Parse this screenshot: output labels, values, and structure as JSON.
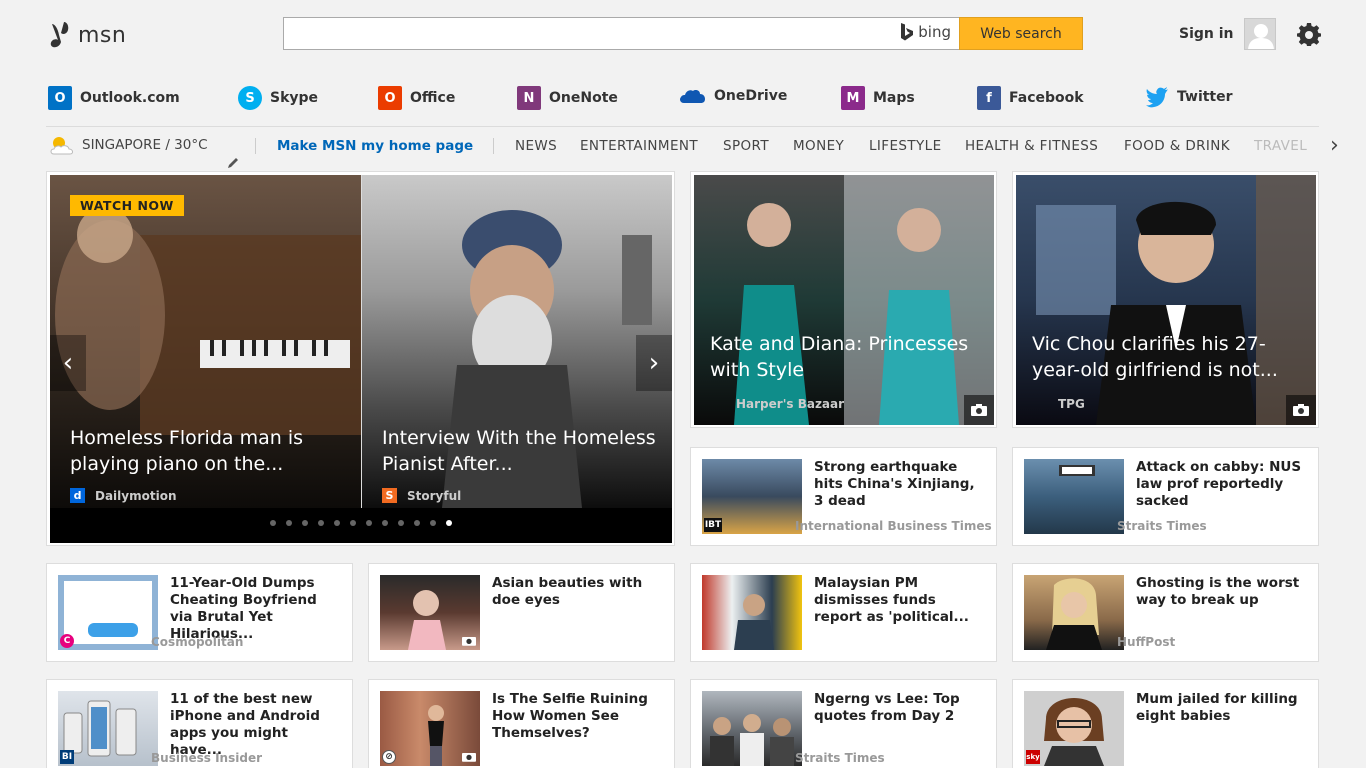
{
  "header": {
    "logo_text": "msn",
    "search_placeholder": "",
    "bing_label": "bing",
    "search_button": "Web search",
    "signin": "Sign in"
  },
  "apps": [
    {
      "label": "Outlook.com",
      "icon": "outlook-icon",
      "color": "#0072c6"
    },
    {
      "label": "Skype",
      "icon": "skype-icon",
      "color": "#00aff0"
    },
    {
      "label": "Office",
      "icon": "office-icon",
      "color": "#eb3c00"
    },
    {
      "label": "OneNote",
      "icon": "onenote-icon",
      "color": "#80397b"
    },
    {
      "label": "OneDrive",
      "icon": "onedrive-icon",
      "color": "#0f57b2"
    },
    {
      "label": "Maps",
      "icon": "maps-icon",
      "color": "#8b2a8b"
    },
    {
      "label": "Facebook",
      "icon": "facebook-icon",
      "color": "#3b5998"
    },
    {
      "label": "Twitter",
      "icon": "twitter-icon",
      "color": "#1da1f2"
    }
  ],
  "nav": {
    "weather": "SINGAPORE / 30°C",
    "homepage_link": "Make MSN my home page",
    "items": [
      "NEWS",
      "ENTERTAINMENT",
      "SPORT",
      "MONEY",
      "LIFESTYLE",
      "HEALTH & FITNESS",
      "FOOD & DRINK",
      "TRAVEL"
    ],
    "more": "›"
  },
  "hero": {
    "badge": "WATCH NOW",
    "slides": [
      {
        "title": "Homeless Florida man is playing piano on the...",
        "source": "Dailymotion",
        "source_color": "#0066dc",
        "source_letter": "d"
      },
      {
        "title": "Interview With the Homeless Pianist After...",
        "source": "Storyful",
        "source_color": "#f26b21",
        "source_letter": "S"
      }
    ],
    "dots_total": 12,
    "dots_active": 12
  },
  "photo_cards": [
    {
      "title": "Kate and Diana: Princesses with Style",
      "source": "Harper's Bazaar"
    },
    {
      "title": "Vic Chou clarifies his 27-year-old girlfriend is not...",
      "source": "TPG"
    }
  ],
  "cards": [
    {
      "title": "Strong earthquake hits China's Xinjiang, 3 dead",
      "source": "International Business Times"
    },
    {
      "title": "Attack on cabby: NUS law prof reportedly sacked",
      "source": "Straits Times"
    },
    {
      "title": "11-Year-Old Dumps Cheating Boyfriend via Brutal Yet Hilarious...",
      "source": "Cosmopolitan"
    },
    {
      "title": "Asian beauties with doe eyes",
      "source": ""
    },
    {
      "title": "Malaysian PM dismisses funds report as 'political...",
      "source": ""
    },
    {
      "title": "Ghosting is the worst way to break up",
      "source": "HuffPost"
    },
    {
      "title": "11 of the best new iPhone and Android apps you might have...",
      "source": "Business Insider"
    },
    {
      "title": "Is The Selfie Ruining How Women See Themselves?",
      "source": ""
    },
    {
      "title": "Ngerng vs Lee: Top quotes from Day 2",
      "source": "Straits Times"
    },
    {
      "title": "Mum jailed for killing eight babies",
      "source": ""
    }
  ]
}
